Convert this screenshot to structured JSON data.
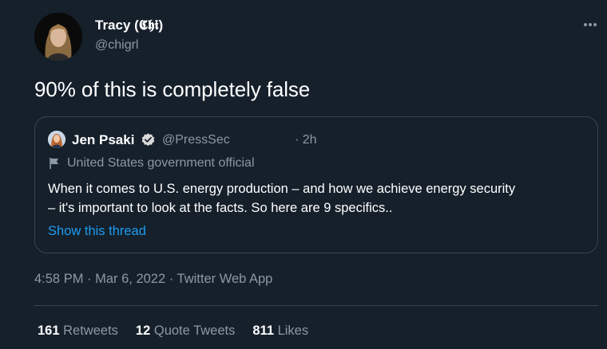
{
  "tweet": {
    "author_name": "Tracy (𝕮𝖍𝖎)",
    "author_handle": "@chigrl",
    "text": "90% of this is completely false",
    "timestamp": "4:58 PM · Mar 6, 2022 · Twitter Web App"
  },
  "quoted": {
    "name": "Jen Psaki",
    "handle": "@PressSec",
    "time": "· 2h",
    "label": "United States government official",
    "text_line1": "When it comes to U.S. energy production – and how we achieve energy security",
    "text_line2": "– it's important to look at the facts. So here are 9 specifics..",
    "show_thread": "Show this thread"
  },
  "stats": {
    "retweets_count": "161",
    "retweets_label": "Retweets",
    "quotes_count": "12",
    "quotes_label": "Quote Tweets",
    "likes_count": "811",
    "likes_label": "Likes"
  },
  "colors": {
    "background": "#15202b",
    "secondary_text": "#8b98a5",
    "accent": "#1d9bf0",
    "border": "#38444d"
  },
  "icons": [
    "more-icon",
    "verified-badge-icon",
    "flag-icon"
  ]
}
